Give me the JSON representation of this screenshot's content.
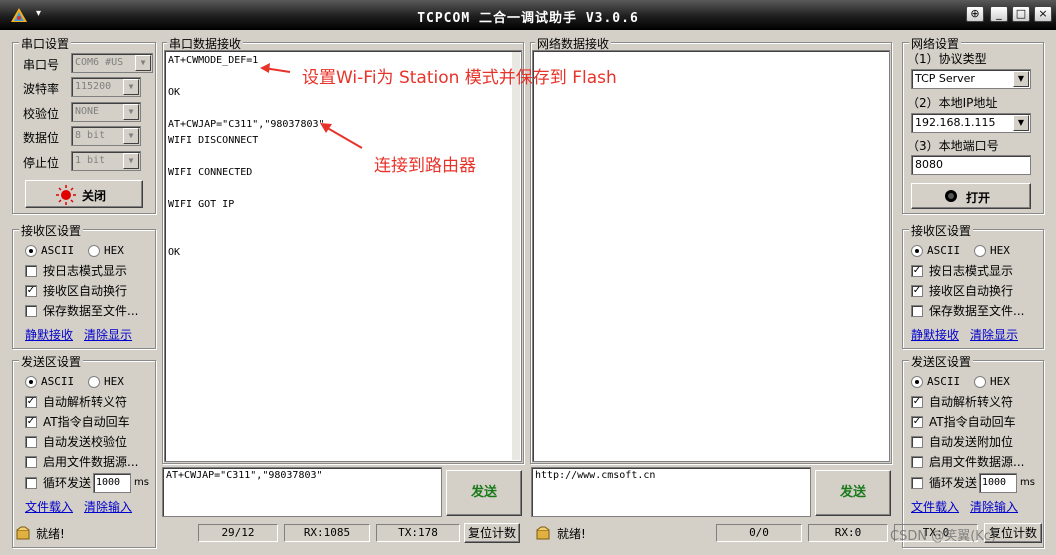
{
  "window": {
    "title": "TCPCOM 二合一调试助手  V3.0.6",
    "buttons": {
      "pin": "⊕",
      "minimize": "_",
      "maximize": "□",
      "close": "×"
    }
  },
  "serial_settings": {
    "legend": "串口设置",
    "port": {
      "label": "串口号",
      "value": "COM6 #US"
    },
    "baud": {
      "label": "波特率",
      "value": "115200"
    },
    "parity": {
      "label": "校验位",
      "value": "NONE"
    },
    "databits": {
      "label": "数据位",
      "value": "8 bit"
    },
    "stopbits": {
      "label": "停止位",
      "value": "1 bit"
    },
    "close_button": "关闭"
  },
  "left_receive": {
    "legend": "接收区设置",
    "ascii": "ASCII",
    "hex": "HEX",
    "log_mode": "按日志模式显示",
    "auto_wrap": "接收区自动换行",
    "save_to_file": "保存数据至文件...",
    "silent_receive": "静默接收",
    "clear_display": "清除显示"
  },
  "left_send": {
    "legend": "发送区设置",
    "ascii": "ASCII",
    "hex": "HEX",
    "auto_escape": "自动解析转义符",
    "at_cr": "AT指令自动回车",
    "auto_checksum": "自动发送校验位",
    "file_source": "启用文件数据源...",
    "loop_send": "循环发送",
    "loop_value": "1000",
    "loop_unit": "ms",
    "load_file": "文件载入",
    "clear_input": "清除输入"
  },
  "serial_receive": {
    "legend": "串口数据接收",
    "lines": [
      "AT+CWMODE_DEF=1",
      "",
      "OK",
      "",
      "AT+CWJAP=\"C311\",\"98037803\"",
      "WIFI DISCONNECT",
      "",
      "WIFI CONNECTED",
      "",
      "WIFI GOT IP",
      "",
      "",
      "OK"
    ]
  },
  "network_receive": {
    "legend": "网络数据接收"
  },
  "serial_send": {
    "text": "AT+CWJAP=\"C311\",\"98037803\"",
    "send_button": "发送"
  },
  "network_send": {
    "text": "http://www.cmsoft.cn",
    "send_button": "发送"
  },
  "annotations": {
    "wifi_station": "设置Wi-Fi为 Station 模式并保存到 Flash",
    "connect_router": "连接到路由器"
  },
  "net_settings": {
    "legend": "网络设置",
    "protocol_label": "（1）协议类型",
    "protocol_value": "TCP Server",
    "ip_label": "（2）本地IP地址",
    "ip_value": "192.168.1.115",
    "port_label": "（3）本地端口号",
    "port_value": "8080",
    "open_button": "打开"
  },
  "right_receive": {
    "legend": "接收区设置",
    "ascii": "ASCII",
    "hex": "HEX",
    "log_mode": "按日志模式显示",
    "auto_wrap": "接收区自动换行",
    "save_to_file": "保存数据至文件...",
    "silent_receive": "静默接收",
    "clear_display": "清除显示"
  },
  "right_send": {
    "legend": "发送区设置",
    "ascii": "ASCII",
    "hex": "HEX",
    "auto_escape": "自动解析转义符",
    "at_cr": "AT指令自动回车",
    "auto_append": "自动发送附加位",
    "file_source": "启用文件数据源...",
    "loop_send": "循环发送",
    "loop_value": "1000",
    "loop_unit": "ms",
    "load_file": "文件载入",
    "clear_input": "清除输入"
  },
  "statusbar": {
    "left_ready": "就绪!",
    "left_counter": "29/12",
    "left_rx": "RX:1085",
    "left_tx": "TX:178",
    "left_reset": "复位计数",
    "right_ready": "就绪!",
    "right_counter": "0/0",
    "right_rx": "RX:0",
    "right_tx": "TX:0",
    "right_reset": "复位计数"
  },
  "watermark": "CSDN @笑翼(Kc)",
  "colors": {
    "annotation": "#e8332a",
    "link": "#0000cc",
    "record": "#e00000"
  }
}
